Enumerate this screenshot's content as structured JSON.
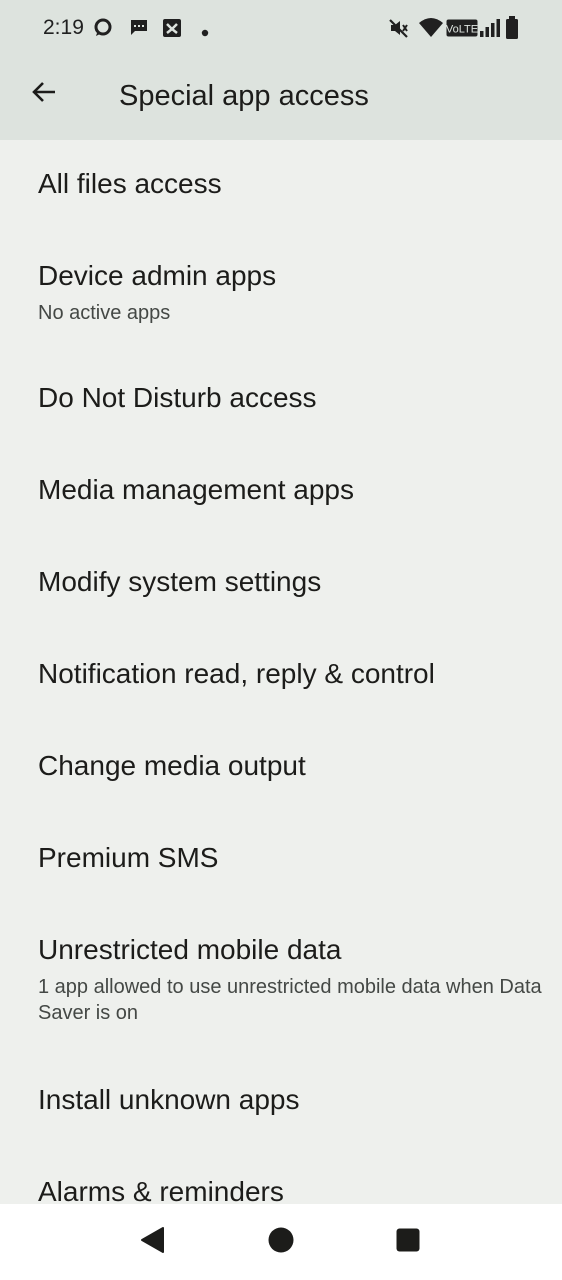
{
  "status_bar": {
    "time": "2:19",
    "network_label": "VoLTE",
    "icons": [
      "chat-bubble-icon",
      "sms-icon",
      "sync-icon",
      "dot-icon",
      "mute-icon",
      "wifi-icon",
      "volte-icon",
      "signal-icon",
      "battery-icon"
    ]
  },
  "app_bar": {
    "title": "Special app access",
    "back_icon": "arrow-back-icon"
  },
  "items": [
    {
      "title": "All files access",
      "summary": ""
    },
    {
      "title": "Device admin apps",
      "summary": "No active apps"
    },
    {
      "title": "Do Not Disturb access",
      "summary": ""
    },
    {
      "title": "Media management apps",
      "summary": ""
    },
    {
      "title": "Modify system settings",
      "summary": ""
    },
    {
      "title": "Notification read, reply & control",
      "summary": ""
    },
    {
      "title": "Change media output",
      "summary": ""
    },
    {
      "title": "Premium SMS",
      "summary": ""
    },
    {
      "title": "Unrestricted mobile data",
      "summary": "1 app allowed to use unrestricted mobile data when Data Saver is on"
    },
    {
      "title": "Install unknown apps",
      "summary": ""
    },
    {
      "title": "Alarms & reminders",
      "summary": ""
    }
  ],
  "nav_bar": {
    "icons": [
      "nav-back-icon",
      "nav-home-icon",
      "nav-recents-icon"
    ]
  },
  "colors": {
    "header_bg": "#dde3de",
    "page_bg": "#eef0ed",
    "text_primary": "#1c1c1a",
    "text_secondary": "#444845",
    "nav_bg": "#ffffff"
  }
}
